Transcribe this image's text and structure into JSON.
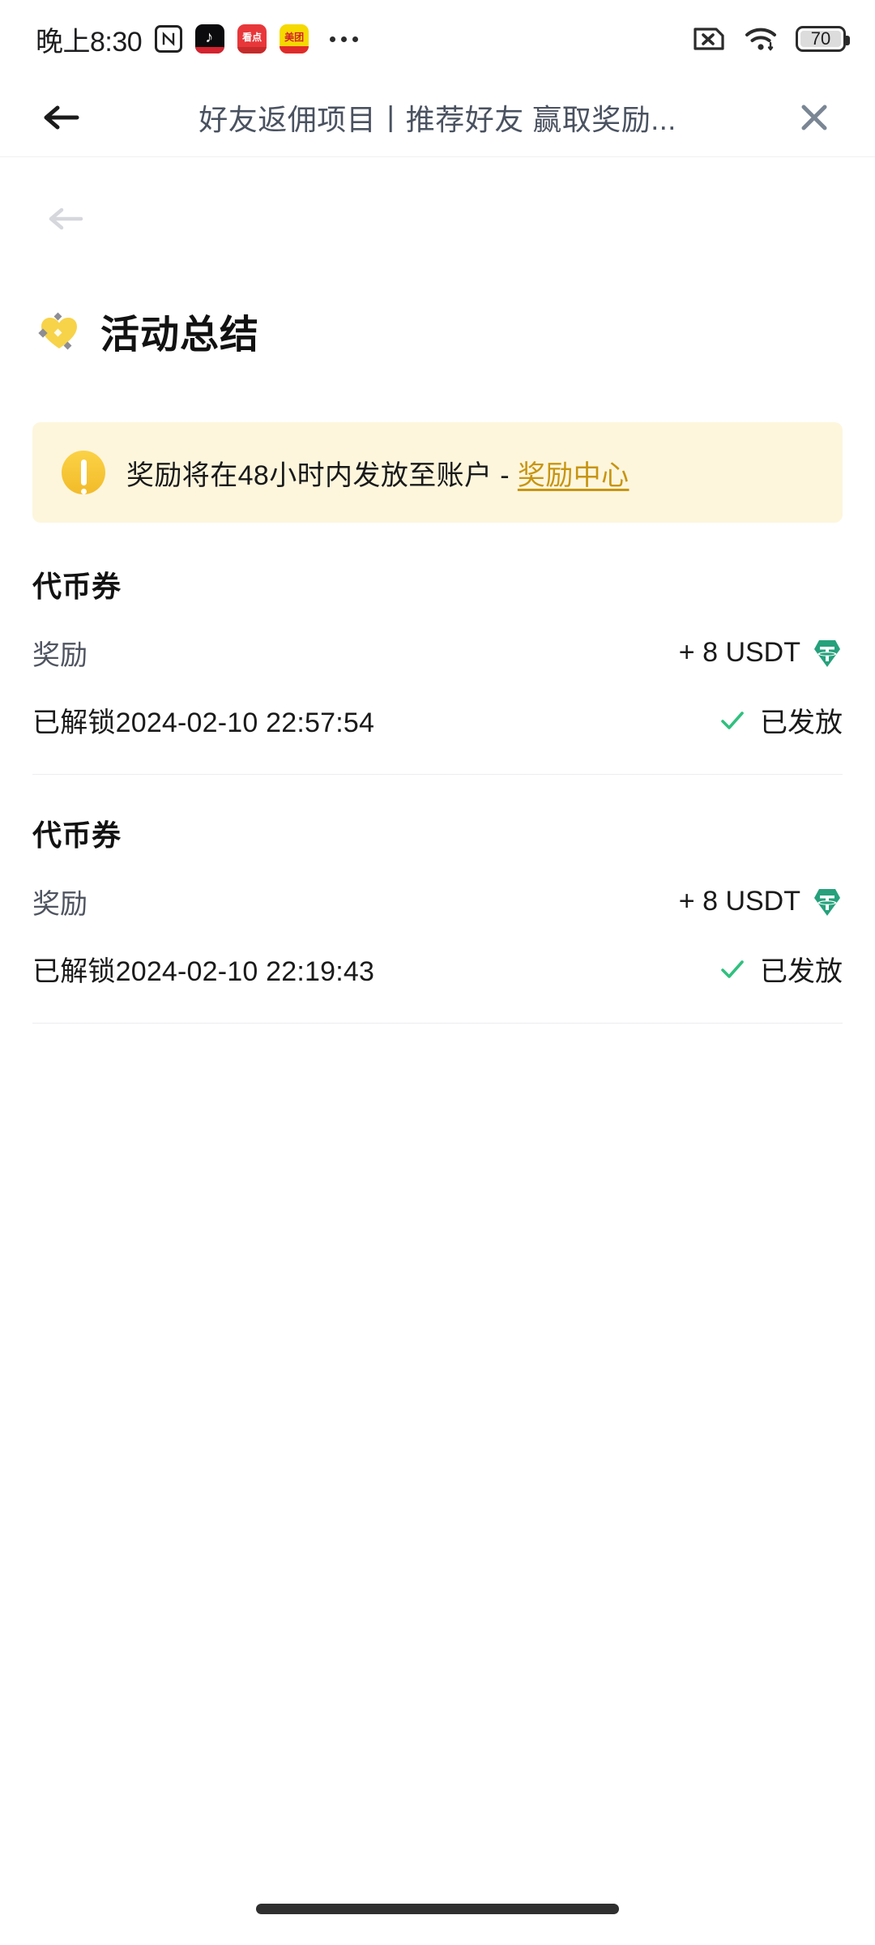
{
  "status_bar": {
    "time": "晚上8:30",
    "nfc_label": "N",
    "app_badges": [
      {
        "name": "tiktok",
        "label": "♪"
      },
      {
        "name": "kandian",
        "label": "看点"
      },
      {
        "name": "meituan",
        "label": "美团"
      }
    ],
    "overflow_dots": "•••",
    "sim_status": "no-sim",
    "wifi_status": "connected",
    "battery_level": "70"
  },
  "nav_bar": {
    "back_label": "←",
    "title": "好友返佣项目丨推荐好友 赢取奖励...",
    "close_label": "✕"
  },
  "page": {
    "back_label": "←",
    "heading": "活动总结",
    "heading_emoji": "sparkling-heart"
  },
  "notice": {
    "text": "奖励将在48小时内发放至账户 - ",
    "link_text": "奖励中心",
    "icon": "warning-exclamation",
    "bg_color": "#fdf6dd",
    "link_color": "#c79512"
  },
  "rewards": [
    {
      "title": "代币券",
      "label": "奖励",
      "amount": "+ 8 USDT",
      "currency_icon": "usdt-tether",
      "date": "已解锁2024-02-10 22:57:54",
      "status": "已发放",
      "status_icon": "check-mark"
    },
    {
      "title": "代币券",
      "label": "奖励",
      "amount": "+ 8 USDT",
      "currency_icon": "usdt-tether",
      "date": "已解锁2024-02-10 22:19:43",
      "status": "已发放",
      "status_icon": "check-mark"
    }
  ],
  "colors": {
    "usdt_green": "#26a17b",
    "check_green": "#30c07f",
    "accent_yellow": "#f2bb2a",
    "nav_title": "#4a5260"
  }
}
